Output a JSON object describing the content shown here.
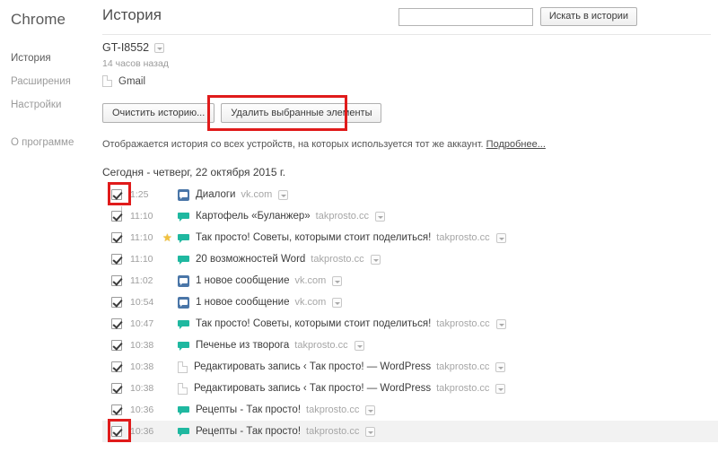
{
  "sidebar": {
    "brand": "Chrome",
    "items": [
      {
        "label": "История",
        "active": true
      },
      {
        "label": "Расширения",
        "active": false
      },
      {
        "label": "Настройки",
        "active": false
      },
      {
        "label": "О программе",
        "active": false
      }
    ]
  },
  "header": {
    "title": "История",
    "search": {
      "value": "",
      "placeholder": ""
    },
    "search_button": "Искать в истории"
  },
  "device": {
    "name": "GT-I8552",
    "dropdown_icon": "chevron-down-icon",
    "synced_time": "14 часов назад",
    "entries": [
      {
        "title": "Gmail",
        "icon": "page-icon"
      }
    ]
  },
  "toolbar": {
    "clear_history_label": "Очистить историю...",
    "delete_selected_label": "Удалить выбранные элементы"
  },
  "info": {
    "text": "Отображается история со всех устройств, на которых используется тот же аккаунт.",
    "link": "Подробнее..."
  },
  "day_heading": "Сегодня - четверг, 22 октября 2015 г.",
  "highlights": {
    "color": "#e01b1b",
    "targets": [
      "delete-selected-button",
      "first-row-checkbox",
      "last-row-checkbox"
    ]
  },
  "history": {
    "rows": [
      {
        "checked": true,
        "time": "1:25",
        "starred": false,
        "favicon": "vk",
        "title": "Диалоги",
        "domain": "vk.com",
        "hovered": false,
        "highlight": true
      },
      {
        "checked": true,
        "time": "11:10",
        "starred": false,
        "favicon": "tp",
        "title": "Картофель «Буланжер»",
        "domain": "takprosto.cc",
        "hovered": false,
        "highlight": false
      },
      {
        "checked": true,
        "time": "11:10",
        "starred": true,
        "favicon": "tp",
        "title": "Так просто! Советы, которыми стоит поделиться!",
        "domain": "takprosto.cc",
        "hovered": false,
        "highlight": false
      },
      {
        "checked": true,
        "time": "11:10",
        "starred": false,
        "favicon": "tp",
        "title": "20 возможностей Word",
        "domain": "takprosto.cc",
        "hovered": false,
        "highlight": false
      },
      {
        "checked": true,
        "time": "11:02",
        "starred": false,
        "favicon": "vk",
        "title": "1 новое сообщение",
        "domain": "vk.com",
        "hovered": false,
        "highlight": false
      },
      {
        "checked": true,
        "time": "10:54",
        "starred": false,
        "favicon": "vk",
        "title": "1 новое сообщение",
        "domain": "vk.com",
        "hovered": false,
        "highlight": false
      },
      {
        "checked": true,
        "time": "10:47",
        "starred": false,
        "favicon": "tp",
        "title": "Так просто! Советы, которыми стоит поделиться!",
        "domain": "takprosto.cc",
        "hovered": false,
        "highlight": false
      },
      {
        "checked": true,
        "time": "10:38",
        "starred": false,
        "favicon": "tp",
        "title": "Печенье из творога",
        "domain": "takprosto.cc",
        "hovered": false,
        "highlight": false
      },
      {
        "checked": true,
        "time": "10:38",
        "starred": false,
        "favicon": "doc",
        "title": "Редактировать запись ‹ Так просто! — WordPress",
        "domain": "takprosto.cc",
        "hovered": false,
        "highlight": false
      },
      {
        "checked": true,
        "time": "10:38",
        "starred": false,
        "favicon": "doc",
        "title": "Редактировать запись ‹ Так просто! — WordPress",
        "domain": "takprosto.cc",
        "hovered": false,
        "highlight": false
      },
      {
        "checked": true,
        "time": "10:36",
        "starred": false,
        "favicon": "tp",
        "title": "Рецепты - Так просто!",
        "domain": "takprosto.cc",
        "hovered": false,
        "highlight": false
      },
      {
        "checked": true,
        "time": "10:36",
        "starred": false,
        "favicon": "tp",
        "title": "Рецепты - Так просто!",
        "domain": "takprosto.cc",
        "hovered": true,
        "highlight": true
      }
    ],
    "star_glyph": "★",
    "row_menu_icon": "chevron-down-icon"
  }
}
